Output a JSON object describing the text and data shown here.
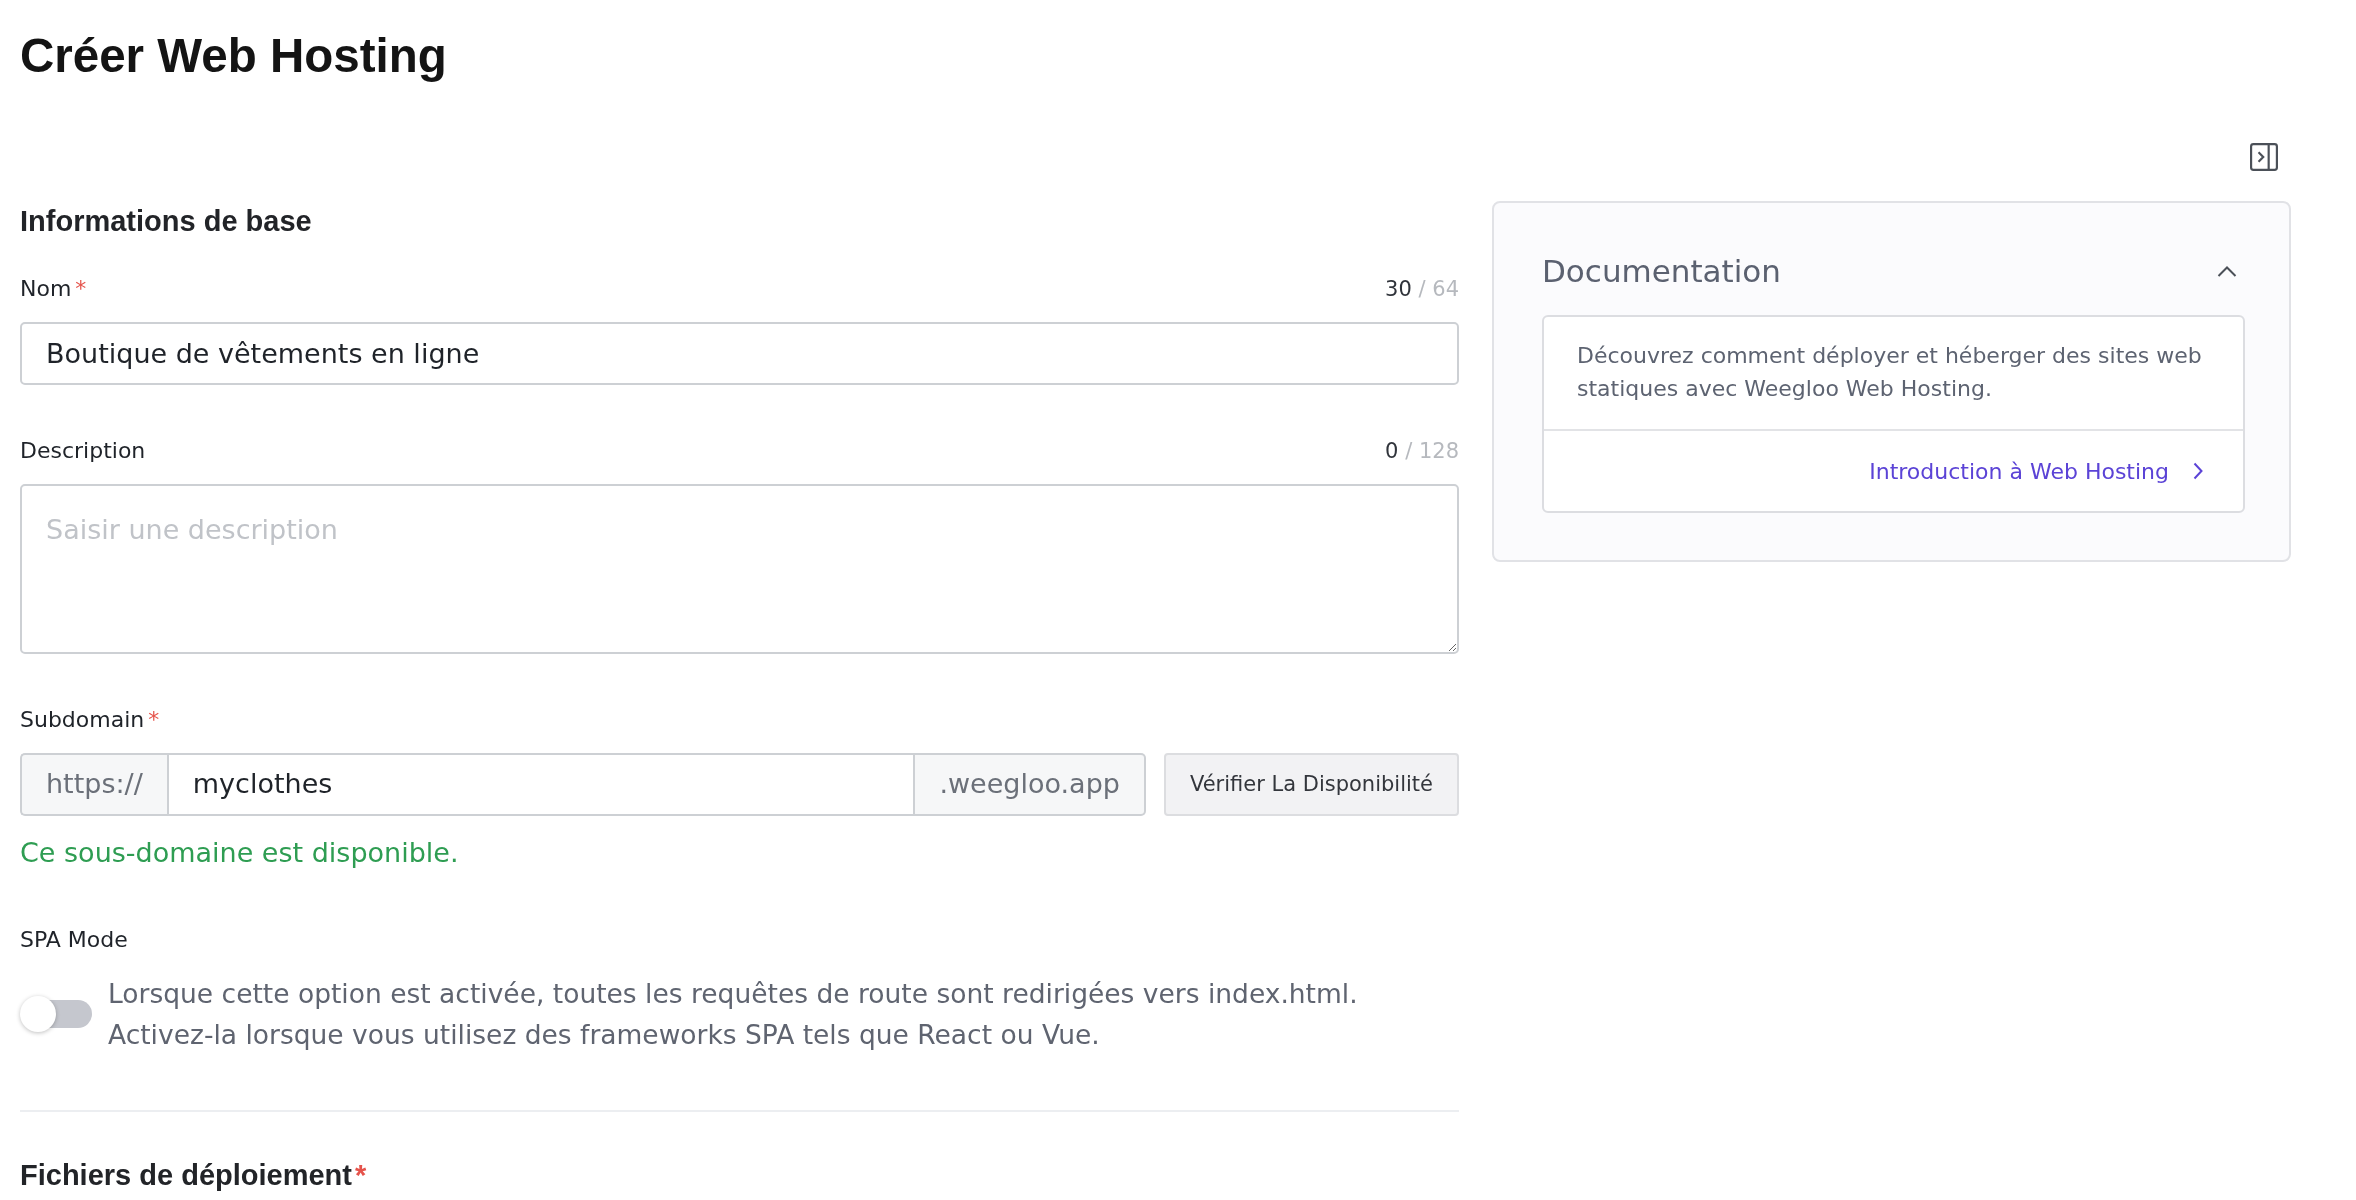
{
  "page": {
    "title": "Créer Web Hosting"
  },
  "basic_info": {
    "heading": "Informations de base",
    "fields": [
      {
        "kind": "text",
        "label": "Nom",
        "required_mark": "*",
        "count": "30",
        "limit": "/ 64",
        "value": "Boutique de vêtements en ligne"
      },
      {
        "kind": "textarea",
        "label": "Description",
        "count": "0",
        "limit": "/ 128",
        "placeholder": "Saisir une description"
      },
      {
        "kind": "subdomain",
        "label": "Subdomain",
        "required_mark": "*",
        "prefix": "https://",
        "value": "myclothes",
        "suffix": ".weegloo.app",
        "button": "Vérifier La Disponibilité",
        "status": {
          "text": "Ce sous-domaine est disponible.",
          "available": true
        }
      },
      {
        "kind": "switch",
        "label": "SPA Mode",
        "on": false,
        "help": [
          "Lorsque cette option est activée, toutes les requêtes de route sont redirigées vers index.html.",
          "Activez-la lorsque vous utilisez des frameworks SPA tels que React ou Vue."
        ]
      }
    ]
  },
  "deployment": {
    "heading": "Fichiers de déploiement",
    "required_mark": "*"
  },
  "documentation": {
    "title": "Documentation",
    "expanded": true,
    "text": "Découvrez comment déployer et héberger des sites web statiques avec Weegloo Web Hosting.",
    "link": "Introduction à Web Hosting"
  }
}
